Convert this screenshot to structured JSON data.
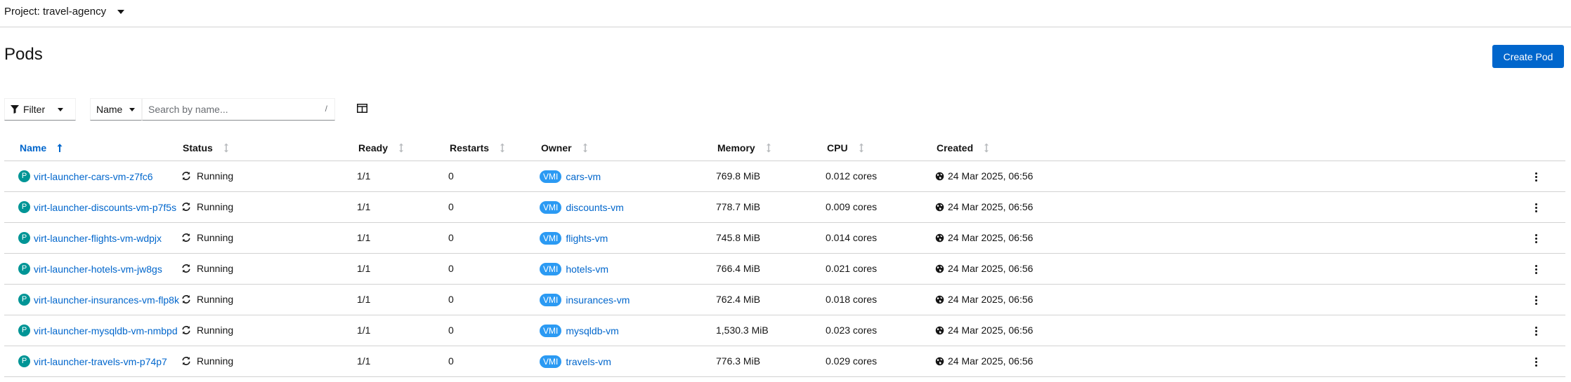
{
  "project": {
    "label": "Project: travel-agency"
  },
  "page": {
    "title": "Pods",
    "create_label": "Create Pod"
  },
  "toolbar": {
    "filter_label": "Filter",
    "name_select": "Name",
    "search_placeholder": "Search by name...",
    "search_value": "",
    "search_hint": "/"
  },
  "columns": [
    "Name",
    "Status",
    "Ready",
    "Restarts",
    "Owner",
    "Memory",
    "CPU",
    "Created"
  ],
  "sorted_column": "Name",
  "owner_badge": "VMI",
  "pod_badge": "P",
  "colors": {
    "link": "#0066cc",
    "primary": "#0066cc",
    "pod_badge": "#009596",
    "vmi_badge": "#2b9af3"
  },
  "rows": [
    {
      "name": "virt-launcher-cars-vm-z7fc6",
      "status": "Running",
      "ready": "1/1",
      "restarts": "0",
      "owner": "cars-vm",
      "memory": "769.8 MiB",
      "cpu": "0.012 cores",
      "created": "24 Mar 2025, 06:56"
    },
    {
      "name": "virt-launcher-discounts-vm-p7f5s",
      "status": "Running",
      "ready": "1/1",
      "restarts": "0",
      "owner": "discounts-vm",
      "memory": "778.7 MiB",
      "cpu": "0.009 cores",
      "created": "24 Mar 2025, 06:56"
    },
    {
      "name": "virt-launcher-flights-vm-wdpjx",
      "status": "Running",
      "ready": "1/1",
      "restarts": "0",
      "owner": "flights-vm",
      "memory": "745.8 MiB",
      "cpu": "0.014 cores",
      "created": "24 Mar 2025, 06:56"
    },
    {
      "name": "virt-launcher-hotels-vm-jw8gs",
      "status": "Running",
      "ready": "1/1",
      "restarts": "0",
      "owner": "hotels-vm",
      "memory": "766.4 MiB",
      "cpu": "0.021 cores",
      "created": "24 Mar 2025, 06:56"
    },
    {
      "name": "virt-launcher-insurances-vm-flp8k",
      "status": "Running",
      "ready": "1/1",
      "restarts": "0",
      "owner": "insurances-vm",
      "memory": "762.4 MiB",
      "cpu": "0.018 cores",
      "created": "24 Mar 2025, 06:56"
    },
    {
      "name": "virt-launcher-mysqldb-vm-nmbpd",
      "status": "Running",
      "ready": "1/1",
      "restarts": "0",
      "owner": "mysqldb-vm",
      "memory": "1,530.3 MiB",
      "cpu": "0.023 cores",
      "created": "24 Mar 2025, 06:56"
    },
    {
      "name": "virt-launcher-travels-vm-p74p7",
      "status": "Running",
      "ready": "1/1",
      "restarts": "0",
      "owner": "travels-vm",
      "memory": "776.3 MiB",
      "cpu": "0.029 cores",
      "created": "24 Mar 2025, 06:56"
    }
  ]
}
